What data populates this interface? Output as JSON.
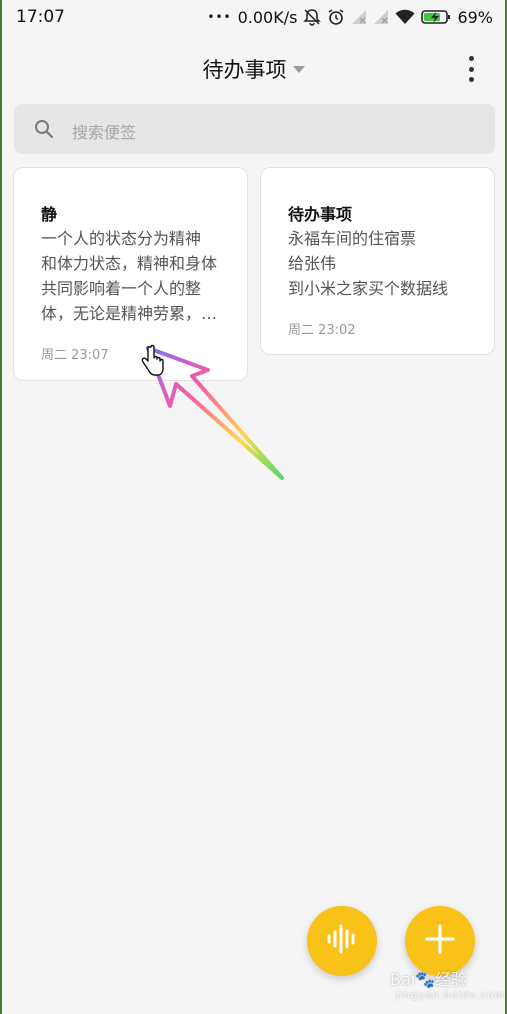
{
  "status_bar": {
    "time": "17:07",
    "dots": "•••",
    "speed": "0.00K/s",
    "battery": "69%",
    "icons": [
      "alarm-off-icon",
      "alarm-clock-icon",
      "signal-icon",
      "signal-icon",
      "wifi-icon",
      "battery-charging-icon"
    ]
  },
  "header": {
    "title": "待办事项",
    "menu_icon": "more-vertical-icon"
  },
  "search": {
    "placeholder": "搜索便签",
    "icon": "search-icon"
  },
  "notes": [
    {
      "title": "静",
      "lines": [
        "一个人的状态分为精神",
        "和体力状态，精神和身体",
        "共同影响着一个人的整",
        "体，无论是精神劳累，…"
      ],
      "date": "周二 23:07"
    },
    {
      "title": "待办事项",
      "lines": [
        "永福车间的住宿票",
        "给张伟",
        "到小米之家买个数据线"
      ],
      "date": "周二 23:02"
    }
  ],
  "fabs": {
    "voice_icon": "voice-waveform-icon",
    "add_icon": "plus-icon",
    "color": "#f9c218"
  },
  "watermark": {
    "text": "Bai🐾经验",
    "sub": "jingyan.baidu.com"
  },
  "colors": {
    "background": "#f5f5f5",
    "card": "#ffffff",
    "accent": "#f9c218"
  }
}
